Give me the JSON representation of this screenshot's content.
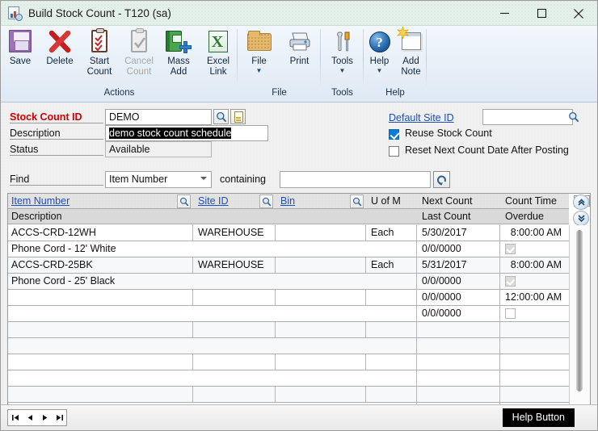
{
  "window": {
    "title": "Build Stock Count  -  T120 (sa)",
    "icon": "stock-count-window-icon",
    "controls": {
      "minimize": "─",
      "maximize": "□",
      "close": "✕"
    }
  },
  "ribbon": {
    "groups": [
      {
        "title": "Actions",
        "buttons": [
          {
            "label": "Save",
            "icon": "floppy-disk-icon",
            "disabled": false,
            "caret": false
          },
          {
            "label": "Delete",
            "icon": "red-x-icon",
            "disabled": false,
            "caret": false
          },
          {
            "label": "Start Count",
            "icon": "clipboard-checklist-icon",
            "disabled": false,
            "caret": false
          },
          {
            "label": "Cancel Count",
            "icon": "clipboard-check-gray-icon",
            "disabled": true,
            "caret": false
          },
          {
            "label": "Mass Add",
            "icon": "green-book-plus-icon",
            "disabled": false,
            "caret": false
          },
          {
            "label": "Excel Link",
            "icon": "excel-icon",
            "disabled": false,
            "caret": false
          }
        ]
      },
      {
        "title": "File",
        "buttons": [
          {
            "label": "File",
            "icon": "folder-icon",
            "disabled": false,
            "caret": true
          },
          {
            "label": "Print",
            "icon": "printer-icon",
            "disabled": false,
            "caret": false
          }
        ]
      },
      {
        "title": "Tools",
        "buttons": [
          {
            "label": "Tools",
            "icon": "wrench-screwdriver-icon",
            "disabled": false,
            "caret": true
          }
        ]
      },
      {
        "title": "Help",
        "buttons": [
          {
            "label": "Help",
            "icon": "blue-question-icon",
            "disabled": false,
            "caret": true
          },
          {
            "label": "Add Note",
            "icon": "note-star-icon",
            "disabled": false,
            "caret": false
          }
        ]
      }
    ]
  },
  "form": {
    "stock_count_id_label": "Stock Count ID",
    "stock_count_id_value": "DEMO",
    "description_label": "Description",
    "description_value": "demo stock count schedule",
    "status_label": "Status",
    "status_value": "Available",
    "default_site_id_label": "Default Site ID",
    "default_site_id_value": "",
    "reuse_stock_count_label": "Reuse Stock Count",
    "reuse_stock_count_checked": true,
    "reset_next_count_label": "Reset Next Count Date After Posting",
    "reset_next_count_checked": false,
    "find_label": "Find",
    "find_field_value": "Item Number",
    "containing_label": "containing",
    "containing_value": ""
  },
  "grid": {
    "headers_row1": [
      "Item Number",
      "Site ID",
      "Bin",
      "U of M",
      "Next Count",
      "Count Time"
    ],
    "headers_row2": [
      "Description",
      "",
      "",
      "",
      "Last Count",
      "Overdue"
    ],
    "rows": [
      {
        "type": "main",
        "item_number": "ACCS-CRD-12WH",
        "site_id": "WAREHOUSE",
        "bin": "",
        "uofm": "Each",
        "next_count": "5/30/2017",
        "count_time": "8:00:00 AM"
      },
      {
        "type": "detail",
        "description": "Phone Cord - 12' White",
        "last_count": "0/0/0000",
        "overdue": true
      },
      {
        "type": "main",
        "item_number": "ACCS-CRD-25BK",
        "site_id": "WAREHOUSE",
        "bin": "",
        "uofm": "Each",
        "next_count": "5/31/2017",
        "count_time": "8:00:00 AM"
      },
      {
        "type": "detail",
        "description": "Phone Cord - 25' Black",
        "last_count": "0/0/0000",
        "overdue": true
      },
      {
        "type": "main",
        "item_number": "",
        "site_id": "",
        "bin": "",
        "uofm": "",
        "next_count": "0/0/0000",
        "count_time": "12:00:00 AM"
      },
      {
        "type": "detail",
        "description": "",
        "last_count": "0/0/0000",
        "overdue": false
      },
      {
        "type": "main",
        "item_number": "",
        "site_id": "",
        "bin": "",
        "uofm": "",
        "next_count": "",
        "count_time": ""
      },
      {
        "type": "detail",
        "description": "",
        "last_count": "",
        "overdue": null
      },
      {
        "type": "main",
        "item_number": "",
        "site_id": "",
        "bin": "",
        "uofm": "",
        "next_count": "",
        "count_time": ""
      },
      {
        "type": "detail",
        "description": "",
        "last_count": "",
        "overdue": null
      },
      {
        "type": "main",
        "item_number": "",
        "site_id": "",
        "bin": "",
        "uofm": "",
        "next_count": "",
        "count_time": ""
      },
      {
        "type": "detail",
        "description": "",
        "last_count": "",
        "overdue": null
      }
    ]
  },
  "statusbar": {
    "nav_first": "first-record",
    "nav_prev": "previous-record",
    "nav_next": "next-record",
    "nav_last": "last-record",
    "help_button_label": "Help Button"
  },
  "colors": {
    "titlebar": "#e4f0ea",
    "ribbon": "#eaf1f9",
    "required_label": "#d40000",
    "link": "#1c4fbb",
    "checkbox_accent": "#0a7cd4",
    "selection": "#000000",
    "help_button_bg": "#000000"
  }
}
